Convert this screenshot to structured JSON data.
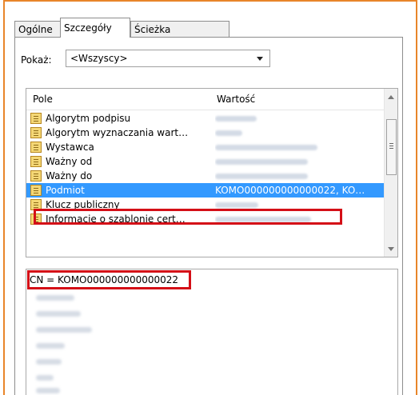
{
  "tabs": [
    {
      "label": "Ogólne"
    },
    {
      "label": "Szczegóły"
    },
    {
      "label": "Ścieżka certyfikacji"
    }
  ],
  "show": {
    "label": "Pokaż:",
    "selected": "<Wszyscy>"
  },
  "list": {
    "columns": [
      "Pole",
      "Wartość"
    ],
    "rows": [
      {
        "field": "Algorytm podpisu",
        "icon": "certificate-field-icon"
      },
      {
        "field": "Algorytm wyznaczania wart…",
        "icon": "certificate-field-icon"
      },
      {
        "field": "Wystawca",
        "icon": "certificate-field-icon"
      },
      {
        "field": "Ważny od",
        "icon": "certificate-field-icon"
      },
      {
        "field": "Ważny do",
        "icon": "certificate-field-icon"
      },
      {
        "field": "Podmiot",
        "value": "KOMO000000000000022, KO…",
        "icon": "certificate-field-icon",
        "selected": true
      },
      {
        "field": "Klucz publiczny",
        "icon": "certificate-field-icon"
      },
      {
        "field": "Informacje o szablonie cert…",
        "icon": "certificate-field-icon"
      }
    ]
  },
  "detail": {
    "line1": "CN = KOMO000000000000022"
  },
  "colors": {
    "highlight": "#d40f17",
    "selection": "#3399ff",
    "frame": "#e8852a"
  }
}
